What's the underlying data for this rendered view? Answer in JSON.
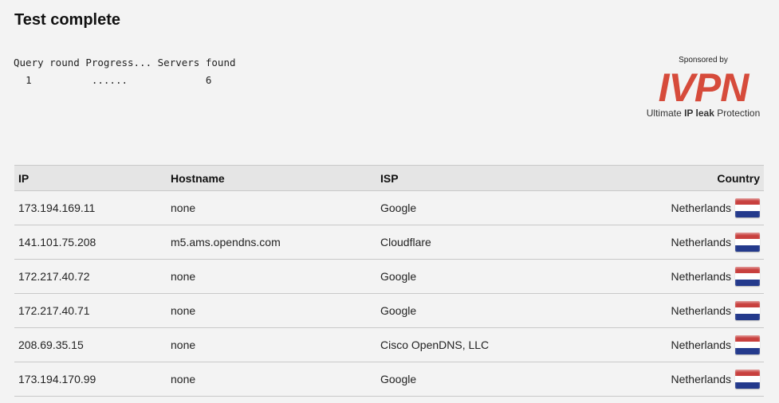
{
  "page": {
    "title": "Test complete"
  },
  "progress": {
    "headers": [
      "Query round",
      "Progress...",
      "Servers found"
    ],
    "row": {
      "round": "1",
      "progress": "......",
      "servers": "6"
    }
  },
  "sponsor": {
    "label": "Sponsored by",
    "brand": "IVPN",
    "tagline_prefix": "Ultimate ",
    "tagline_strong": "IP leak",
    "tagline_suffix": " Protection",
    "brand_color": "#d64b3b"
  },
  "table": {
    "columns": {
      "ip": "IP",
      "hostname": "Hostname",
      "isp": "ISP",
      "country": "Country"
    },
    "rows": [
      {
        "ip": "173.194.169.11",
        "hostname": "none",
        "isp": "Google",
        "country": "Netherlands",
        "flag_icon": "netherlands-flag"
      },
      {
        "ip": "141.101.75.208",
        "hostname": "m5.ams.opendns.com",
        "isp": "Cloudflare",
        "country": "Netherlands",
        "flag_icon": "netherlands-flag"
      },
      {
        "ip": "172.217.40.72",
        "hostname": "none",
        "isp": "Google",
        "country": "Netherlands",
        "flag_icon": "netherlands-flag"
      },
      {
        "ip": "172.217.40.71",
        "hostname": "none",
        "isp": "Google",
        "country": "Netherlands",
        "flag_icon": "netherlands-flag"
      },
      {
        "ip": "208.69.35.15",
        "hostname": "none",
        "isp": "Cisco OpenDNS, LLC",
        "country": "Netherlands",
        "flag_icon": "netherlands-flag"
      },
      {
        "ip": "173.194.170.99",
        "hostname": "none",
        "isp": "Google",
        "country": "Netherlands",
        "flag_icon": "netherlands-flag"
      }
    ]
  }
}
